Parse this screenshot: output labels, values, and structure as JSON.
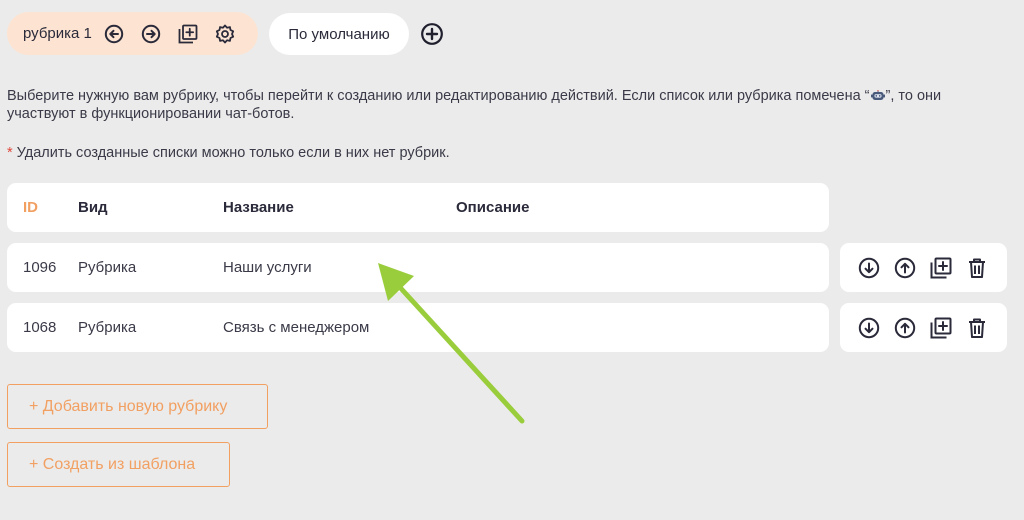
{
  "tabs": {
    "active": {
      "label": "рубрика 1"
    },
    "default": {
      "label": "По умолчанию"
    }
  },
  "info": {
    "text_before": "Выберите нужную вам рубрику, чтобы перейти к созданию или редактированию действий. Если список или рубрика помечена “",
    "text_after": "”, то они участвуют в функционировании чат-ботов."
  },
  "note": {
    "marker": "*",
    "text": "Удалить созданные списки можно только если в них нет рубрик."
  },
  "table": {
    "headers": {
      "id": "ID",
      "type": "Вид",
      "name": "Название",
      "description": "Описание"
    },
    "rows": [
      {
        "id": "1096",
        "type": "Рубрика",
        "name": "Наши услуги",
        "description": ""
      },
      {
        "id": "1068",
        "type": "Рубрика",
        "name": "Связь с менеджером",
        "description": ""
      }
    ]
  },
  "buttons": {
    "add_rubric": "+ Добавить новую рубрику",
    "create_from_template": "+ Создать из шаблона"
  },
  "icons": {
    "tab_tools": [
      "arrow-left-circle-icon",
      "arrow-right-circle-icon",
      "copy-add-icon",
      "settings-gear-icon"
    ],
    "add_tab": "plus-circle-icon",
    "row_actions": [
      "move-down-icon",
      "move-up-icon",
      "copy-add-icon",
      "trash-icon"
    ]
  },
  "colors": {
    "accent": "#f2a062",
    "active_tab_bg": "#fde4d2",
    "page_bg": "#ebebeb",
    "annotation_arrow": "#9acd3c",
    "required_marker": "#e0473a"
  }
}
